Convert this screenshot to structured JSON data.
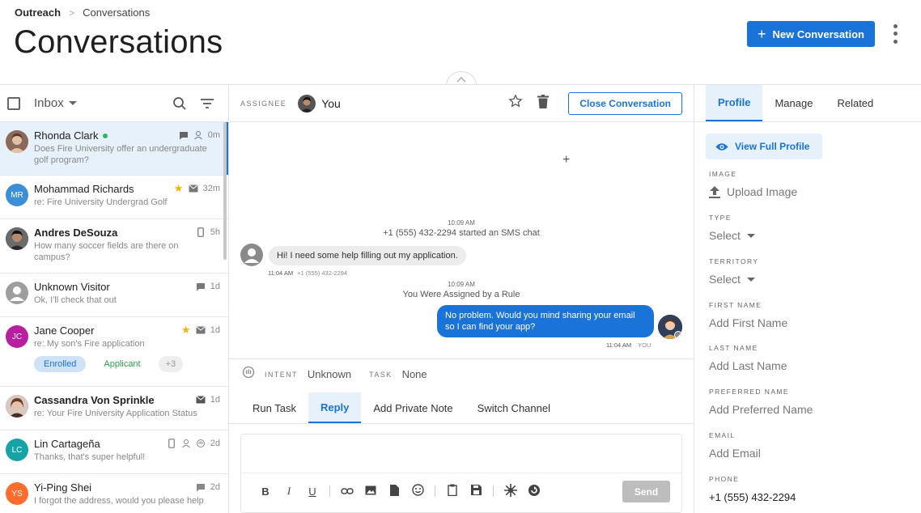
{
  "breadcrumb": {
    "root": "Outreach",
    "separator": ">",
    "current": "Conversations"
  },
  "page": {
    "title": "Conversations"
  },
  "header": {
    "new_conversation_label": "New Conversation",
    "new_conversation_icon": "+"
  },
  "colors": {
    "primary": "#1a73d9",
    "online": "#2eb85c",
    "star": "#f5b400"
  },
  "left_toolbar": {
    "inbox_label": "Inbox"
  },
  "conversations": [
    {
      "name": "Rhonda Clark",
      "time": "0m",
      "preview": "Does Fire University offer an undergraduate golf program?",
      "bold": false,
      "online": true
    },
    {
      "name": "Mohammad Richards",
      "initials": "MR",
      "time": "32m",
      "preview": "re: Fire University Undergrad Golf",
      "starred": true
    },
    {
      "name": "Andres DeSouza",
      "time": "5h",
      "preview": "How many soccer fields are there on campus?",
      "bold": true
    },
    {
      "name": "Unknown Visitor",
      "time": "1d",
      "preview": "Ok, I'll check that out"
    },
    {
      "name": "Jane Cooper",
      "initials": "JC",
      "time": "1d",
      "preview": "re: My son's Fire application",
      "starred": true,
      "tags": [
        "Enrolled",
        "Applicant",
        "+3"
      ]
    },
    {
      "name": "Cassandra Von Sprinkle",
      "time": "1d",
      "preview": "re: Your Fire University Application Status",
      "bold": true
    },
    {
      "name": "Lin Cartageña",
      "initials": "LC",
      "time": "2d",
      "preview": "Thanks, that's super helpful!"
    },
    {
      "name": "Yi-Ping Shei",
      "initials": "YS",
      "time": "2d",
      "preview": "I forgot the address, would you please help"
    }
  ],
  "mid_toolbar": {
    "assignee_label": "ASSIGNEE",
    "assignee_name": "You",
    "close_label": "Close Conversation"
  },
  "chat": {
    "plus": "+",
    "event1_time": "10:09 AM",
    "event1_text": "+1 (555) 432-2294 started an SMS chat",
    "incoming_text": "Hi! I need some help filling out my application.",
    "incoming_time": "11:04 AM",
    "incoming_phone": "+1 (555) 432-2294",
    "event2_time": "10:09 AM",
    "event2_text": "You Were Assigned by a Rule",
    "outgoing_text": "No problem. Would you mind sharing your email so I can find your app?",
    "outgoing_time": "11:04 AM",
    "outgoing_you": "YOU"
  },
  "intent": {
    "intent_label": "INTENT",
    "intent_value": "Unknown",
    "task_label": "TASK",
    "task_value": "None"
  },
  "composer_tabs": [
    "Run Task",
    "Reply",
    "Add Private Note",
    "Switch Channel"
  ],
  "composer": {
    "send_label": "Send",
    "bold": "B",
    "italic": "I",
    "underline": "U"
  },
  "right_tabs": [
    "Profile",
    "Manage",
    "Related"
  ],
  "profile": {
    "view_full_profile": "View Full Profile",
    "image_label": "IMAGE",
    "image_value": "Upload Image",
    "type_label": "TYPE",
    "type_value": "Select",
    "territory_label": "TERRITORY",
    "territory_value": "Select",
    "first_name_label": "FIRST NAME",
    "first_name_value": "Add First Name",
    "last_name_label": "LAST NAME",
    "last_name_value": "Add Last Name",
    "preferred_name_label": "PREFERRED NAME",
    "preferred_name_value": "Add Preferred Name",
    "email_label": "EMAIL",
    "email_value": "Add Email",
    "phone_label": "PHONE",
    "phone_value": "+1 (555) 432-2294"
  }
}
